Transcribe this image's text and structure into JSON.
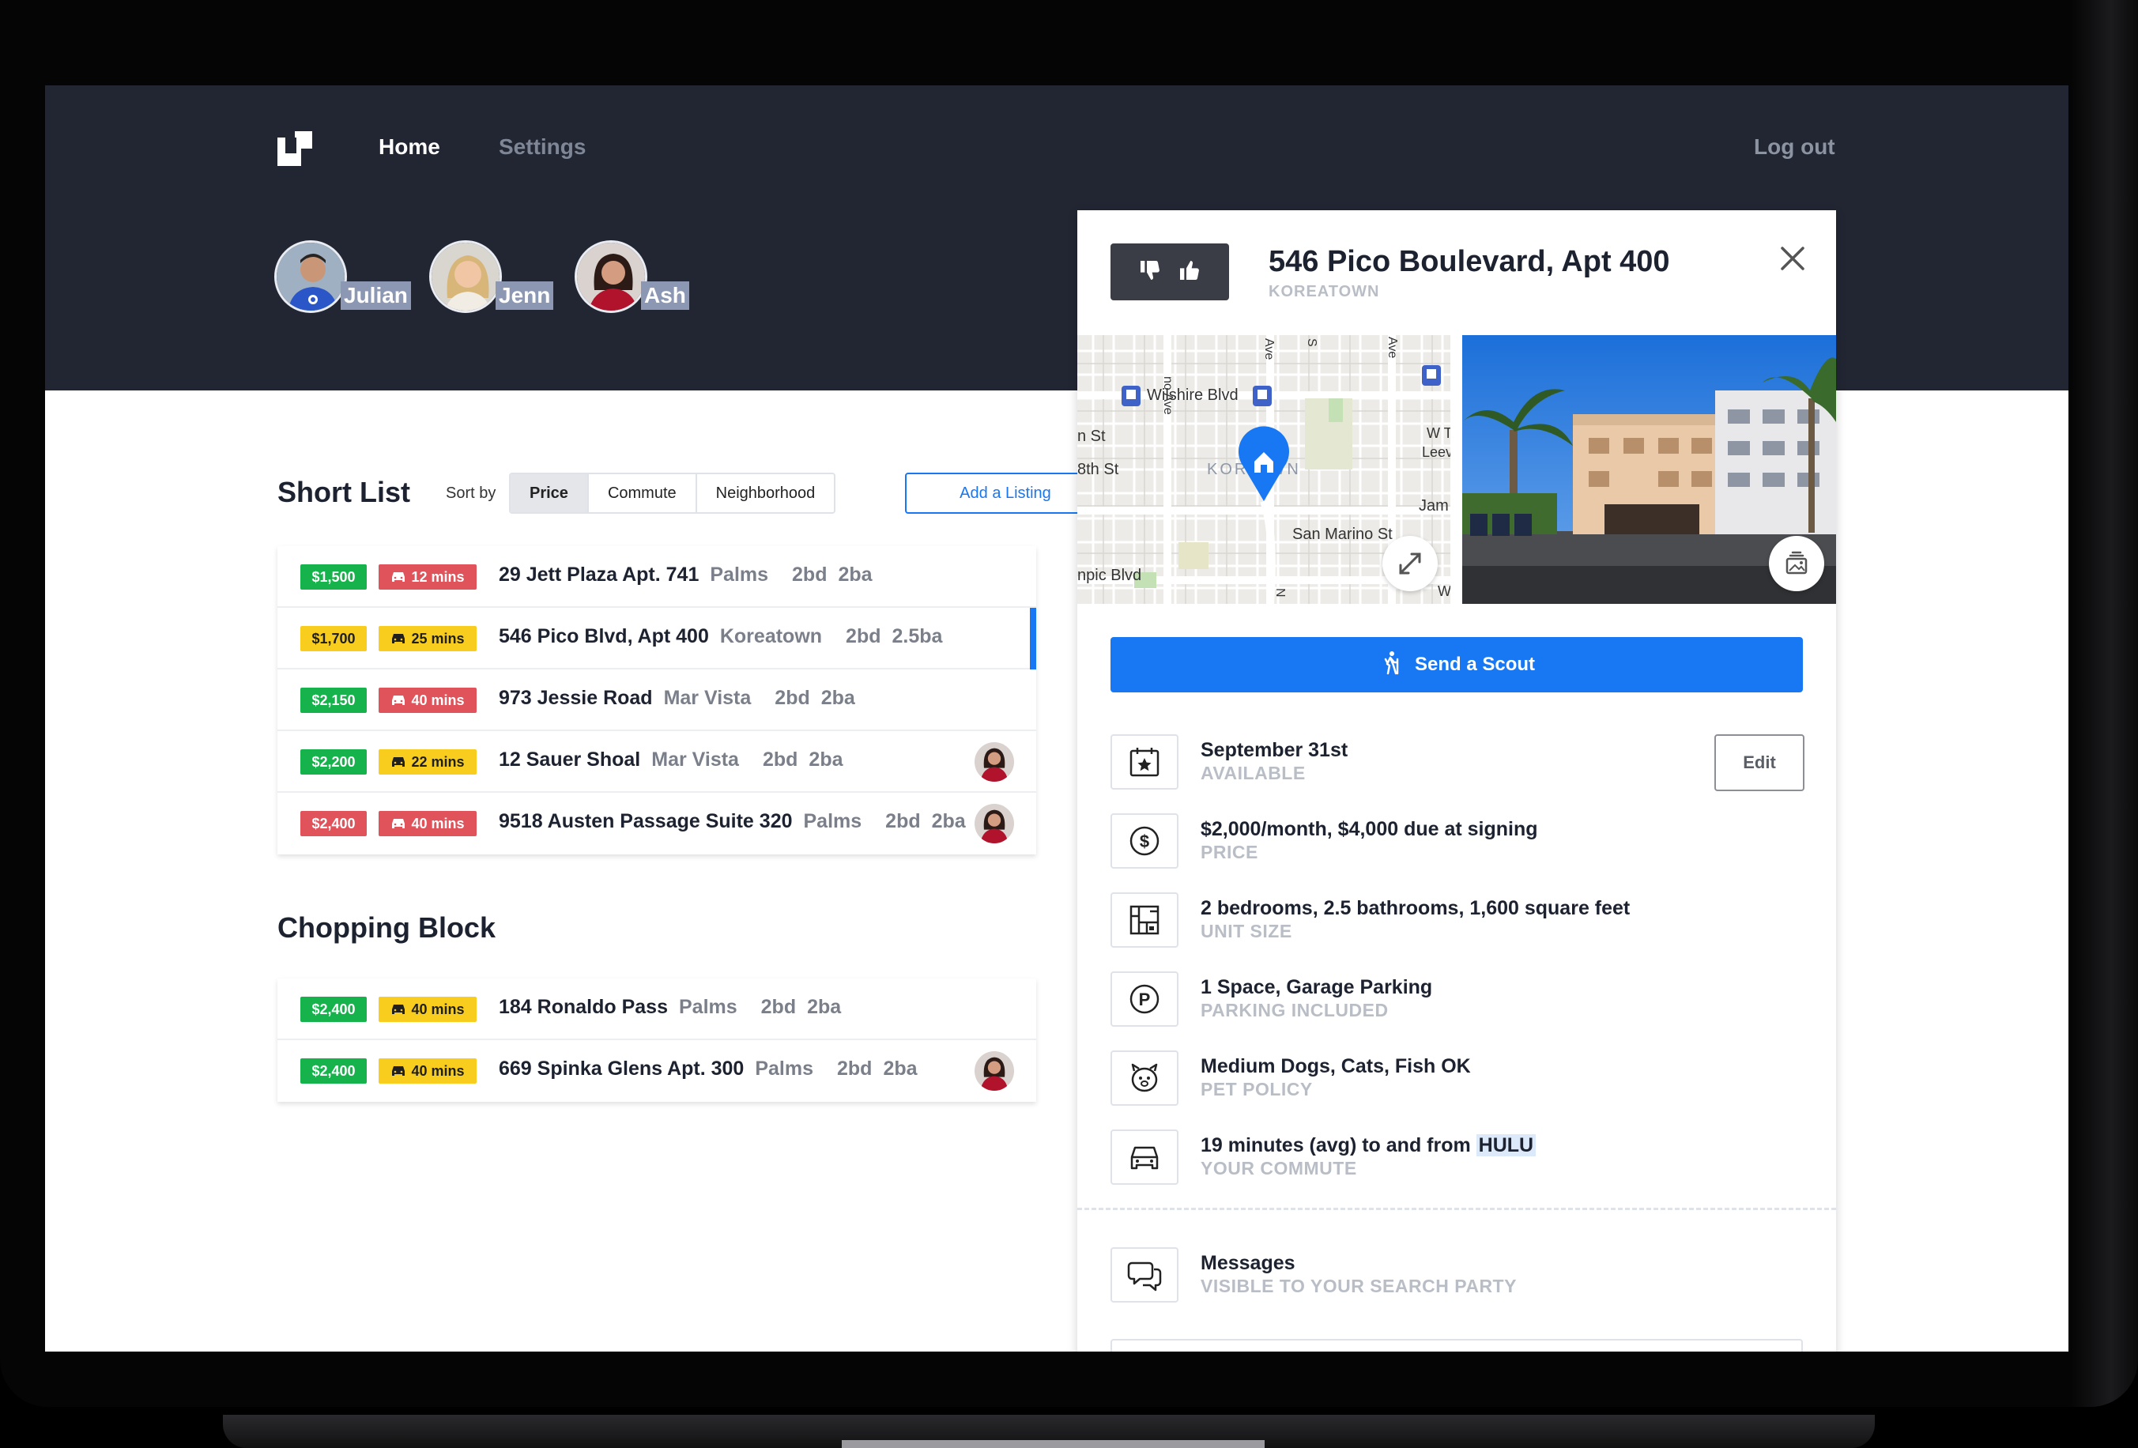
{
  "nav": {
    "home": "Home",
    "settings": "Settings",
    "logout": "Log out"
  },
  "members": [
    {
      "name": "Julian"
    },
    {
      "name": "Jenn"
    },
    {
      "name": "Ash"
    }
  ],
  "short_list": {
    "title": "Short List",
    "sort_label": "Sort by",
    "sort_options": [
      "Price",
      "Commute",
      "Neighborhood"
    ],
    "sort_active": "Price",
    "add_button": "Add a Listing",
    "rows": [
      {
        "price": "$1,500",
        "price_color": "green",
        "commute": "12 mins",
        "commute_color": "red",
        "address": "29 Jett Plaza Apt. 741",
        "neighborhood": "Palms",
        "beds": "2bd",
        "baths": "2ba",
        "avatar": false,
        "selected": false
      },
      {
        "price": "$1,700",
        "price_color": "yellow",
        "commute": "25 mins",
        "commute_color": "yellow",
        "address": "546 Pico Blvd, Apt 400",
        "neighborhood": "Koreatown",
        "beds": "2bd",
        "baths": "2.5ba",
        "avatar": false,
        "selected": true
      },
      {
        "price": "$2,150",
        "price_color": "green",
        "commute": "40 mins",
        "commute_color": "red",
        "address": "973 Jessie Road",
        "neighborhood": "Mar Vista",
        "beds": "2bd",
        "baths": "2ba",
        "avatar": false,
        "selected": false
      },
      {
        "price": "$2,200",
        "price_color": "green",
        "commute": "22 mins",
        "commute_color": "yellow",
        "address": "12 Sauer Shoal",
        "neighborhood": "Mar Vista",
        "beds": "2bd",
        "baths": "2ba",
        "avatar": true,
        "selected": false
      },
      {
        "price": "$2,400",
        "price_color": "red",
        "commute": "40 mins",
        "commute_color": "red",
        "address": "9518 Austen Passage Suite 320",
        "neighborhood": "Palms",
        "beds": "2bd",
        "baths": "2ba",
        "avatar": true,
        "selected": false
      }
    ]
  },
  "chopping_block": {
    "title": "Chopping Block",
    "rows": [
      {
        "price": "$2,400",
        "price_color": "green",
        "commute": "40 mins",
        "commute_color": "yellow",
        "address": "184 Ronaldo Pass",
        "neighborhood": "Palms",
        "beds": "2bd",
        "baths": "2ba",
        "avatar": false,
        "selected": false
      },
      {
        "price": "$2,400",
        "price_color": "green",
        "commute": "40 mins",
        "commute_color": "yellow",
        "address": "669 Spinka Glens Apt. 300",
        "neighborhood": "Palms",
        "beds": "2bd",
        "baths": "2ba",
        "avatar": true,
        "selected": false
      }
    ]
  },
  "detail": {
    "title": "546 Pico Boulevard, Apt 400",
    "neighborhood": "KOREATOWN",
    "map_labels": {
      "street_main": "Wilshire Blvd",
      "street_8th": "8th St",
      "street_n": "n St",
      "street_sanmarino": "San Marino St",
      "street_pico": "npic Blvd",
      "district": "KOR      OWN",
      "jam": "Jam",
      "leev": "Leev",
      "wt": "W T",
      "ave1": "no Ave",
      "ave2": "Ave",
      "ave3": "S",
      "ave4": "Ave",
      "ave5": "N",
      "w": "W"
    },
    "scout_button": "Send a Scout",
    "edit_button": "Edit",
    "facts": [
      {
        "main": "September 31st",
        "sub": "AVAILABLE",
        "icon": "calendar-icon"
      },
      {
        "main": "$2,000/month, $4,000 due at signing",
        "sub": "PRICE",
        "icon": "dollar-icon"
      },
      {
        "main": "2 bedrooms, 2.5 bathrooms, 1,600 square feet",
        "sub": "UNIT SIZE",
        "icon": "floorplan-icon"
      },
      {
        "main": "1 Space, Garage Parking",
        "sub": "PARKING INCLUDED",
        "icon": "parking-icon"
      },
      {
        "main": "Medium Dogs, Cats, Fish OK",
        "sub": "PET POLICY",
        "icon": "pet-icon"
      },
      {
        "main": "19 minutes (avg) to and from",
        "main_highlight": "HULU",
        "sub": "YOUR COMMUTE",
        "icon": "car-icon"
      }
    ],
    "messages": {
      "main": "Messages",
      "sub": "VISIBLE TO YOUR SEARCH PARTY",
      "icon": "chat-icon"
    }
  },
  "colors": {
    "header_bg": "#222633",
    "accent": "#1877f2",
    "green": "#16b24b",
    "red": "#e0535b",
    "yellow": "#f8cd1d"
  }
}
